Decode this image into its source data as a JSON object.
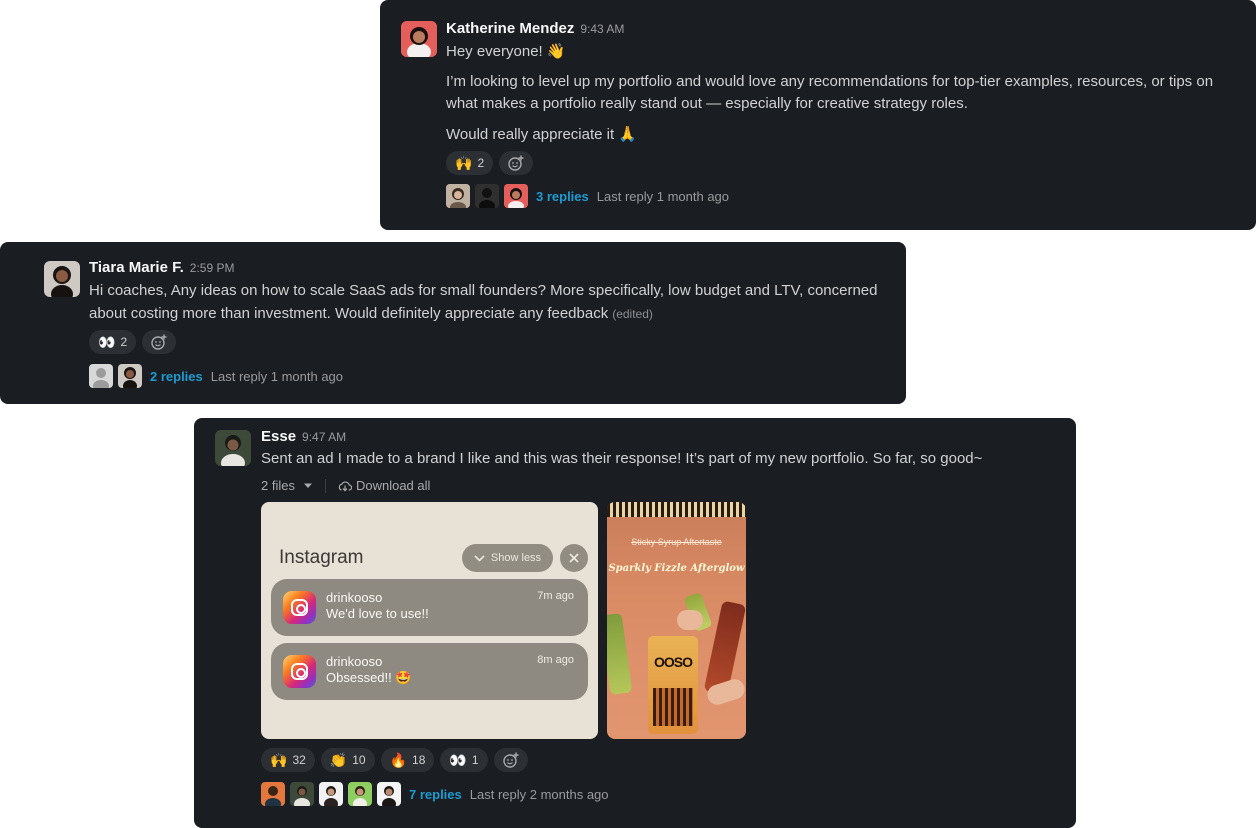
{
  "messages": [
    {
      "author": "Katherine Mendez",
      "time": "9:43 AM",
      "lines": [
        "Hey everyone! 👋",
        "I’m looking to level up my portfolio and would love any recommendations for top-tier examples, resources, or tips on",
        "what makes a portfolio really stand out — especially for creative strategy roles.",
        "Would really appreciate it 🙏"
      ],
      "reactions": [
        {
          "emoji": "🙌",
          "count": "2"
        }
      ],
      "reply_count": "3 replies",
      "last_reply": "Last reply 1 month ago"
    },
    {
      "author": "Tiara Marie F.",
      "time": "2:59 PM",
      "lines": [
        "Hi coaches, Any ideas on how to scale SaaS ads for small founders? More specifically, low budget and LTV, concerned",
        "about costing more than investment. Would definitely appreciate any feedback"
      ],
      "edited": "(edited)",
      "reactions": [
        {
          "emoji": "👀",
          "count": "2"
        }
      ],
      "reply_count": "2 replies",
      "last_reply": "Last reply 1 month ago"
    },
    {
      "author": "Esse",
      "time": "9:47 AM",
      "lines": [
        "Sent an ad I made to a brand I like and this was their response! It’s part of my new portfolio. So far, so good~"
      ],
      "files_label": "2 files",
      "download_label": "Download all",
      "reactions": [
        {
          "emoji": "🙌",
          "count": "32"
        },
        {
          "emoji": "👏",
          "count": "10"
        },
        {
          "emoji": "🔥",
          "count": "18"
        },
        {
          "emoji": "👀",
          "count": "1"
        }
      ],
      "reply_count": "7 replies",
      "last_reply": "Last reply 2 months ago"
    }
  ],
  "instagram_attachment": {
    "title": "Instagram",
    "show_less": "Show less",
    "notifications": [
      {
        "sender": "drinkooso",
        "message": "We'd love to use!!",
        "ago": "7m ago"
      },
      {
        "sender": "drinkooso",
        "message": "Obsessed!! 🤩",
        "ago": "8m ago"
      }
    ]
  },
  "poster_attachment": {
    "struck_text": "Sticky Syrup Aftertaste",
    "headline": "Sparkly Fizzle Afterglow",
    "can_logo": "OOSO"
  },
  "colors": {
    "card_bg": "#1a1d21",
    "link": "#1d9bd1",
    "reaction_bg": "#2c2f34"
  },
  "icons": {
    "add_reaction": "add-reaction-icon",
    "dropdown": "chevron-down-icon",
    "download": "cloud-download-icon",
    "close": "close-icon"
  }
}
